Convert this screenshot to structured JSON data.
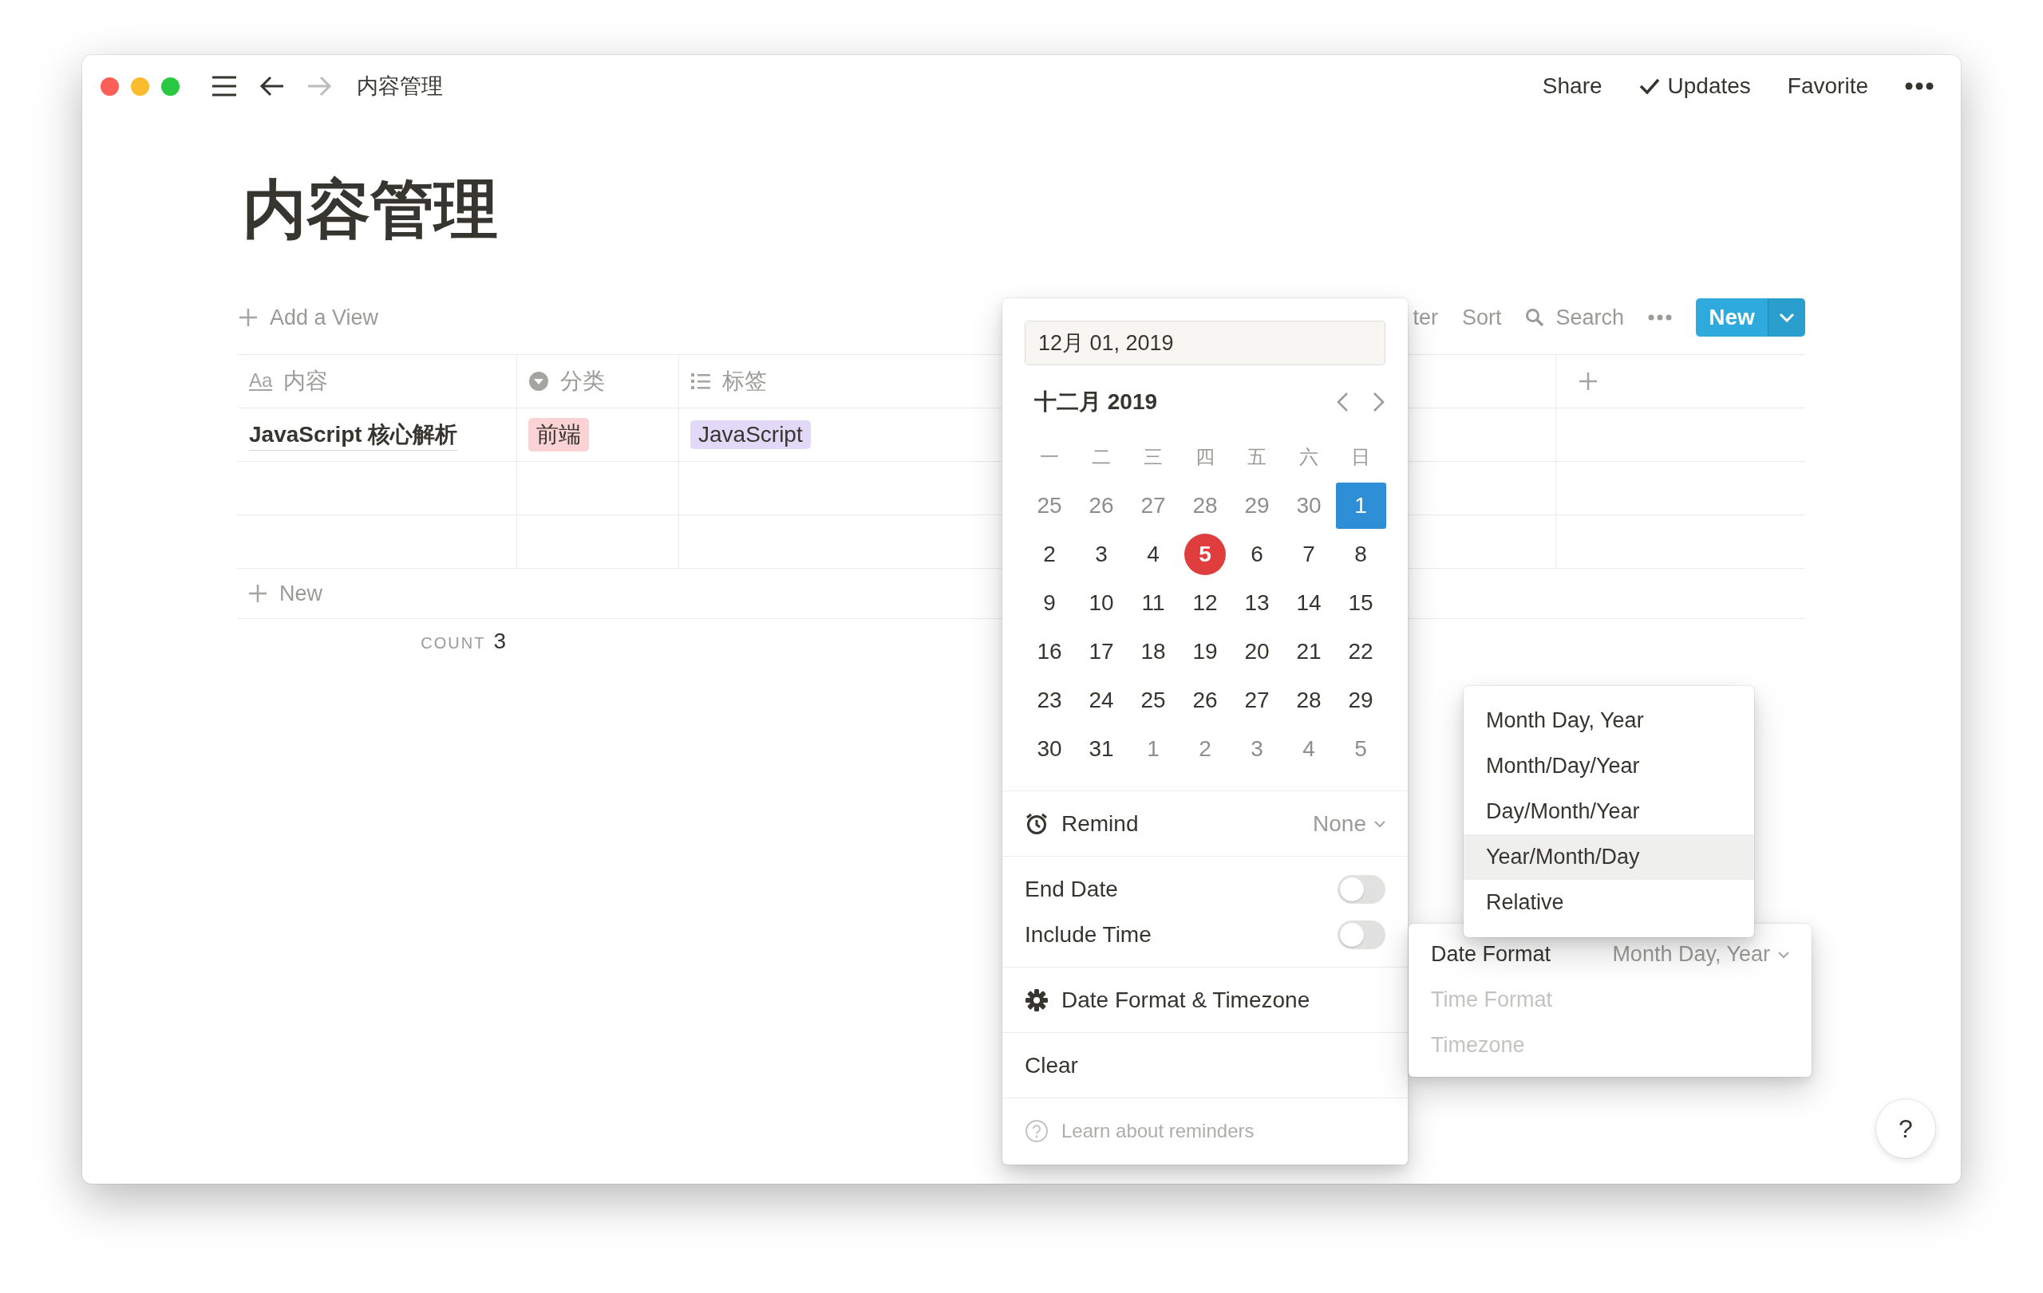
{
  "window": {
    "title": "内容管理"
  },
  "topbar": {
    "actions": [
      {
        "label": "Share",
        "kind": "text"
      },
      {
        "label": "Updates",
        "kind": "check"
      },
      {
        "label": "Favorite",
        "kind": "text"
      }
    ]
  },
  "page": {
    "title": "内容管理"
  },
  "toolbar": {
    "add_view": "Add a View",
    "actions": [
      {
        "label": "ter",
        "kind": "text"
      },
      {
        "label": "Sort",
        "kind": "text"
      },
      {
        "label": "Search",
        "kind": "search"
      },
      {
        "kind": "more"
      }
    ],
    "new_button": "New"
  },
  "table": {
    "columns": [
      {
        "label": "内容",
        "kind": "title",
        "glyph": "Aa"
      },
      {
        "label": "分类",
        "kind": "select"
      },
      {
        "label": "标签",
        "kind": "multi_select"
      }
    ],
    "rows": [
      {
        "cells": [
          {
            "text": "JavaScript 核心解析"
          },
          {
            "tag": "前端",
            "color": "#fcd3d5"
          },
          {
            "tag": "JavaScript",
            "color": "#e2d8f8"
          }
        ]
      },
      {
        "cells": []
      },
      {
        "cells": []
      }
    ],
    "new_row": "New",
    "count": {
      "label": "COUNT",
      "value": "3"
    }
  },
  "date_picker": {
    "date_field": {
      "value": "12月 01, 2019"
    },
    "month": "十二月 2019",
    "weekdays": [
      "一",
      "二",
      "三",
      "四",
      "五",
      "六",
      "日"
    ],
    "days": [
      {
        "label": "25",
        "outside": true,
        "selected": false,
        "today": false
      },
      {
        "label": "26",
        "outside": true,
        "selected": false,
        "today": false
      },
      {
        "label": "27",
        "outside": true,
        "selected": false,
        "today": false
      },
      {
        "label": "28",
        "outside": true,
        "selected": false,
        "today": false
      },
      {
        "label": "29",
        "outside": true,
        "selected": false,
        "today": false
      },
      {
        "label": "30",
        "outside": true,
        "selected": false,
        "today": false
      },
      {
        "label": "1",
        "outside": false,
        "selected": true,
        "today": false
      },
      {
        "label": "2",
        "outside": false,
        "selected": false,
        "today": false
      },
      {
        "label": "3",
        "outside": false,
        "selected": false,
        "today": false
      },
      {
        "label": "4",
        "outside": false,
        "selected": false,
        "today": false
      },
      {
        "label": "5",
        "outside": false,
        "selected": false,
        "today": true
      },
      {
        "label": "6",
        "outside": false,
        "selected": false,
        "today": false
      },
      {
        "label": "7",
        "outside": false,
        "selected": false,
        "today": false
      },
      {
        "label": "8",
        "outside": false,
        "selected": false,
        "today": false
      },
      {
        "label": "9",
        "outside": false,
        "selected": false,
        "today": false
      },
      {
        "label": "10",
        "outside": false,
        "selected": false,
        "today": false
      },
      {
        "label": "11",
        "outside": false,
        "selected": false,
        "today": false
      },
      {
        "label": "12",
        "outside": false,
        "selected": false,
        "today": false
      },
      {
        "label": "13",
        "outside": false,
        "selected": false,
        "today": false
      },
      {
        "label": "14",
        "outside": false,
        "selected": false,
        "today": false
      },
      {
        "label": "15",
        "outside": false,
        "selected": false,
        "today": false
      },
      {
        "label": "16",
        "outside": false,
        "selected": false,
        "today": false
      },
      {
        "label": "17",
        "outside": false,
        "selected": false,
        "today": false
      },
      {
        "label": "18",
        "outside": false,
        "selected": false,
        "today": false
      },
      {
        "label": "19",
        "outside": false,
        "selected": false,
        "today": false
      },
      {
        "label": "20",
        "outside": false,
        "selected": false,
        "today": false
      },
      {
        "label": "21",
        "outside": false,
        "selected": false,
        "today": false
      },
      {
        "label": "22",
        "outside": false,
        "selected": false,
        "today": false
      },
      {
        "label": "23",
        "outside": false,
        "selected": false,
        "today": false
      },
      {
        "label": "24",
        "outside": false,
        "selected": false,
        "today": false
      },
      {
        "label": "25",
        "outside": false,
        "selected": false,
        "today": false
      },
      {
        "label": "26",
        "outside": false,
        "selected": false,
        "today": false
      },
      {
        "label": "27",
        "outside": false,
        "selected": false,
        "today": false
      },
      {
        "label": "28",
        "outside": false,
        "selected": false,
        "today": false
      },
      {
        "label": "29",
        "outside": false,
        "selected": false,
        "today": false
      },
      {
        "label": "30",
        "outside": false,
        "selected": false,
        "today": false
      },
      {
        "label": "31",
        "outside": false,
        "selected": false,
        "today": false
      },
      {
        "label": "1",
        "outside": true,
        "selected": false,
        "today": false
      },
      {
        "label": "2",
        "outside": true,
        "selected": false,
        "today": false
      },
      {
        "label": "3",
        "outside": true,
        "selected": false,
        "today": false
      },
      {
        "label": "4",
        "outside": true,
        "selected": false,
        "today": false
      },
      {
        "label": "5",
        "outside": true,
        "selected": false,
        "today": false
      }
    ],
    "remind": {
      "label": "Remind",
      "value": "None"
    },
    "toggles": [
      {
        "label": "End Date",
        "on": false
      },
      {
        "label": "Include Time",
        "on": false
      }
    ],
    "settings": "Date Format & Timezone",
    "clear": "Clear",
    "help_link": "Learn about reminders"
  },
  "format_menu": {
    "items": [
      {
        "label": "Month Day, Year",
        "hovered": false
      },
      {
        "label": "Month/Day/Year",
        "hovered": false
      },
      {
        "label": "Day/Month/Year",
        "hovered": false
      },
      {
        "label": "Year/Month/Day",
        "hovered": true
      },
      {
        "label": "Relative",
        "hovered": false
      }
    ]
  },
  "date_format_panel": {
    "rows": [
      {
        "label": "Date Format",
        "value": "Month Day, Year",
        "disabled": false
      },
      {
        "label": "Time Format",
        "disabled": true
      },
      {
        "label": "Timezone",
        "disabled": true
      }
    ]
  },
  "help_button": "?"
}
